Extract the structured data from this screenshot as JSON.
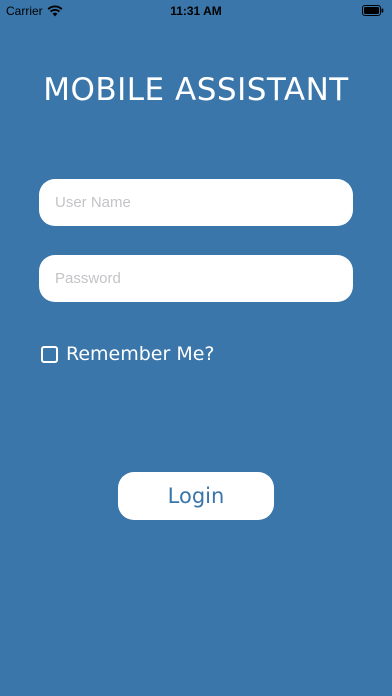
{
  "status_bar": {
    "carrier": "Carrier",
    "time": "11:31 AM"
  },
  "app": {
    "title": "MOBILE ASSISTANT"
  },
  "form": {
    "username_placeholder": "User Name",
    "username_value": "",
    "password_placeholder": "Password",
    "password_value": "",
    "remember_label": "Remember Me?",
    "remember_checked": false,
    "login_label": "Login"
  },
  "colors": {
    "background": "#3a76aa",
    "field_background": "#ffffff",
    "button_text": "#3a76aa"
  }
}
